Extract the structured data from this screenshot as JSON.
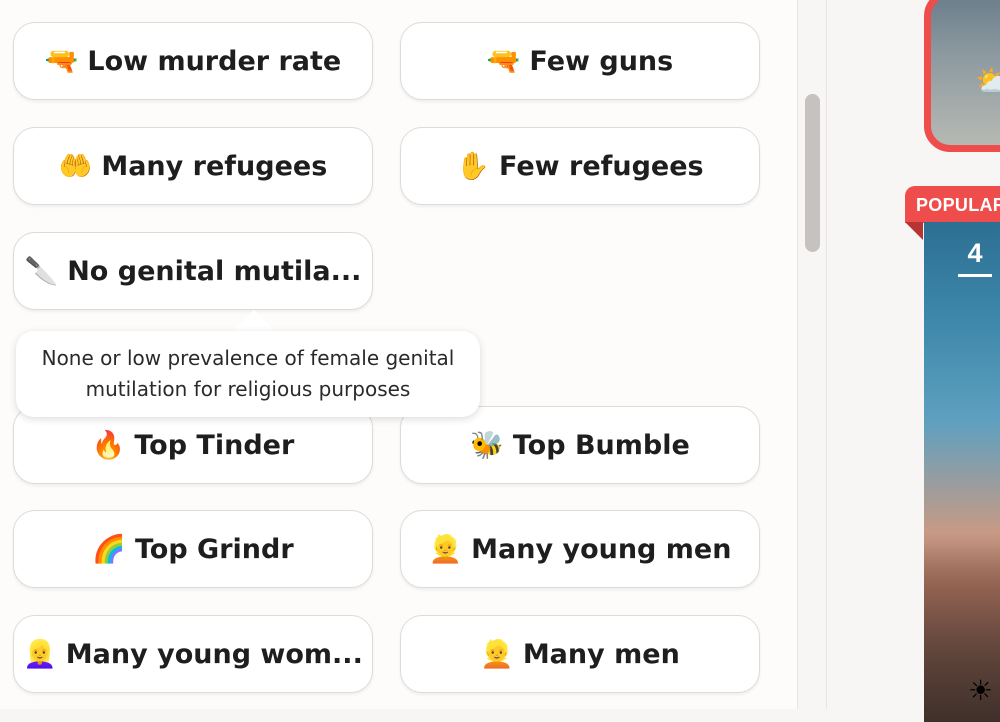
{
  "filters": [
    {
      "emoji": "🔫",
      "label": "Low murder rate"
    },
    {
      "emoji": "🔫",
      "label": "Few guns"
    },
    {
      "emoji": "🤲",
      "label": "Many refugees"
    },
    {
      "emoji": "✋",
      "label": "Few refugees"
    },
    {
      "emoji": "🔪",
      "label": "No genital mutila..."
    },
    {
      "emoji": "🔥",
      "label": "Top Tinder"
    },
    {
      "emoji": "🐝",
      "label": "Top Bumble"
    },
    {
      "emoji": "🌈",
      "label": "Top Grindr"
    },
    {
      "emoji": "👱",
      "label": "Many young men"
    },
    {
      "emoji": "👱‍♀️",
      "label": "Many young wom..."
    },
    {
      "emoji": "👱",
      "label": "Many men"
    }
  ],
  "tooltip": {
    "text": "None or low prevalence of female genital\nmutilation for religious purposes"
  },
  "side": {
    "badge": "POPULAR",
    "rank": "4",
    "weather_icon": "partly-cloudy-icon"
  },
  "colors": {
    "accent": "#ef4c4c",
    "chip_border": "#dedbd7",
    "text": "#1e1e1e"
  }
}
